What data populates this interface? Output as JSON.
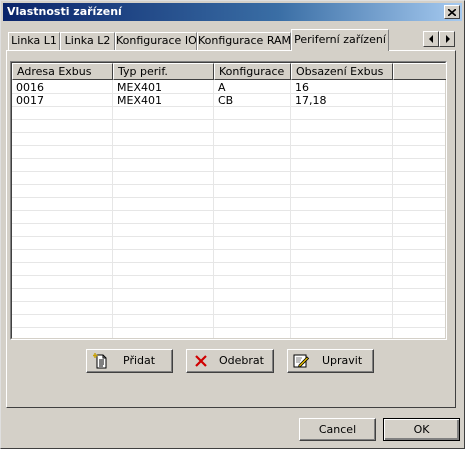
{
  "window": {
    "title": "Vlastnosti zařízení"
  },
  "icons": {
    "close": "close-icon",
    "tab_left": "arrow-left-icon",
    "tab_right": "arrow-right-icon",
    "add": "add-document-icon",
    "remove": "red-x-icon",
    "edit": "edit-pencil-icon"
  },
  "tabs": [
    {
      "label": "Linka L1"
    },
    {
      "label": "Linka L2"
    },
    {
      "label": "Konfigurace IO"
    },
    {
      "label": "Konfigurace RAM"
    },
    {
      "label": "Periferní zařízení",
      "active": true
    }
  ],
  "table": {
    "columns": [
      "Adresa Exbus",
      "Typ perif.",
      "Konfigurace",
      "Obsazení Exbus"
    ],
    "rows": [
      [
        "0016",
        "MEX401",
        "A",
        "16"
      ],
      [
        "0017",
        "MEX401",
        "CB",
        "17,18"
      ]
    ]
  },
  "actions": {
    "add": "Přidat",
    "remove": "Odebrat",
    "edit": "Upravit"
  },
  "dialog": {
    "cancel": "Cancel",
    "ok": "OK"
  }
}
